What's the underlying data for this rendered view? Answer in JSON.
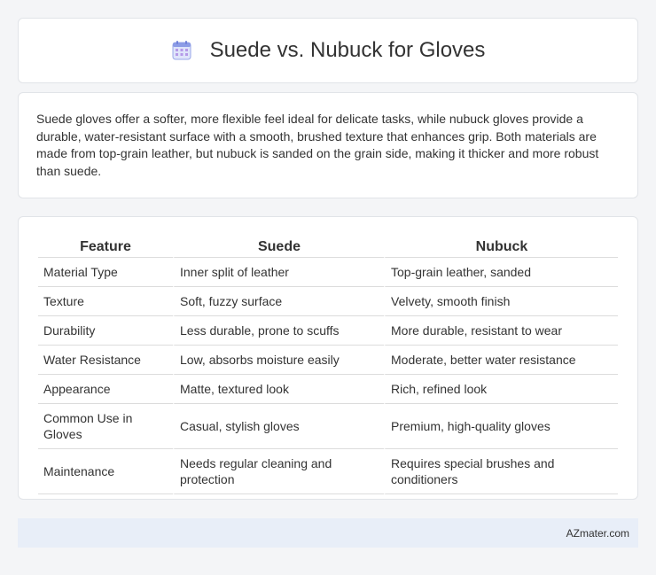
{
  "header": {
    "title": "Suede vs. Nubuck for Gloves",
    "icon": "calendar-icon"
  },
  "intro": {
    "text": "Suede gloves offer a softer, more flexible feel ideal for delicate tasks, while nubuck gloves provide a durable, water-resistant surface with a smooth, brushed texture that enhances grip. Both materials are made from top-grain leather, but nubuck is sanded on the grain side, making it thicker and more robust than suede."
  },
  "table": {
    "headers": [
      "Feature",
      "Suede",
      "Nubuck"
    ],
    "rows": [
      [
        "Material Type",
        "Inner split of leather",
        "Top-grain leather, sanded"
      ],
      [
        "Texture",
        "Soft, fuzzy surface",
        "Velvety, smooth finish"
      ],
      [
        "Durability",
        "Less durable, prone to scuffs",
        "More durable, resistant to wear"
      ],
      [
        "Water Resistance",
        "Low, absorbs moisture easily",
        "Moderate, better water resistance"
      ],
      [
        "Appearance",
        "Matte, textured look",
        "Rich, refined look"
      ],
      [
        "Common Use in Gloves",
        "Casual, stylish gloves",
        "Premium, high-quality gloves"
      ],
      [
        "Maintenance",
        "Needs regular cleaning and protection",
        "Requires special brushes and conditioners"
      ]
    ]
  },
  "footer": {
    "brand": "AZmater.com"
  },
  "colors": {
    "background": "#f4f5f7",
    "card": "#ffffff",
    "footer": "#e8eef8",
    "icon_accent": "#7b8fe0"
  }
}
